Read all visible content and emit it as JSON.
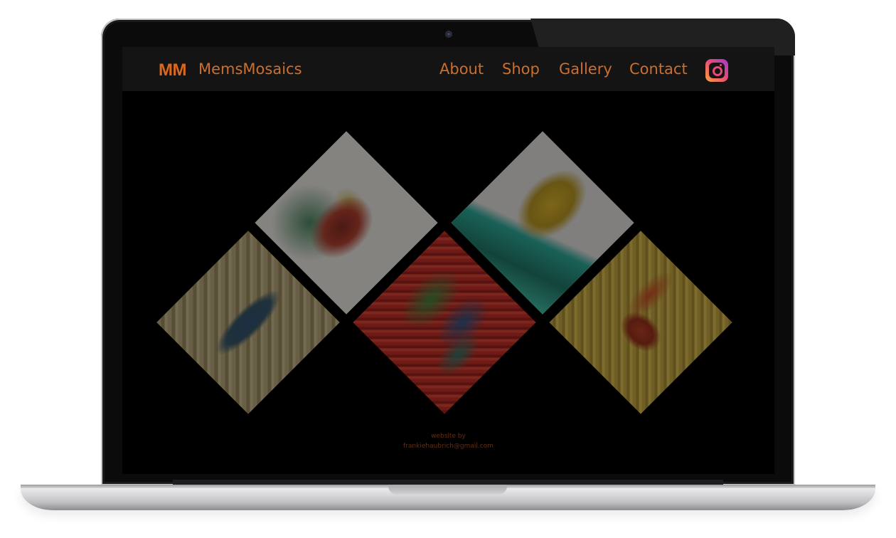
{
  "brand": {
    "mark": "MM",
    "name": "MemsMosaics"
  },
  "nav": {
    "items": [
      {
        "label": "About"
      },
      {
        "label": "Shop"
      },
      {
        "label": "Gallery"
      },
      {
        "label": "Contact"
      }
    ],
    "instagram_icon": "instagram-icon"
  },
  "gallery": {
    "tiles": [
      {
        "subject": "beetle"
      },
      {
        "subject": "sail"
      },
      {
        "subject": "lizard"
      },
      {
        "subject": "parrots"
      },
      {
        "subject": "bird"
      }
    ]
  },
  "footer": {
    "line1": "website by",
    "line2": "frankiehaubrich@gmail.com"
  },
  "colors": {
    "accent": "#cc6e2e",
    "navbar_bg": "#141414",
    "page_bg": "#000000"
  }
}
